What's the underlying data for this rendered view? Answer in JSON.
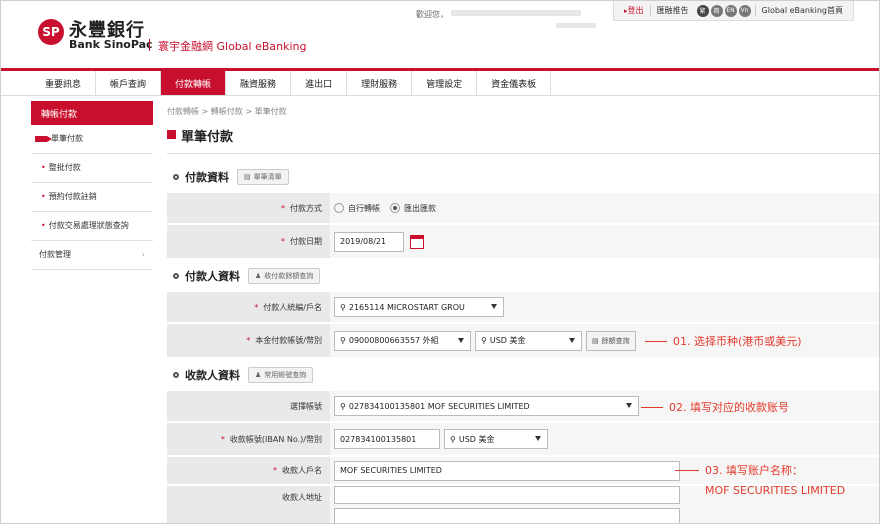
{
  "header": {
    "logo_mark": "SP",
    "brand_cn": "永豐銀行",
    "brand_en": "Bank SinoPac",
    "tagline": "寰宇金融網 Global eBanking",
    "welcome": "歡迎您，",
    "logout": "登出",
    "logout_icon": "triangle-right-icon",
    "links": [
      "匯融推告"
    ],
    "circles": [
      "繁",
      "简",
      "EN",
      "Vn"
    ],
    "home": "Global eBanking首頁"
  },
  "nav": {
    "items": [
      "重要訊息",
      "帳戶查詢",
      "付款轉帳",
      "融資服務",
      "進出口",
      "理財服務",
      "管理設定",
      "資金儀表板"
    ],
    "active_index": 2
  },
  "sidebar": {
    "title": "轉帳付款",
    "items": [
      {
        "label": "單筆付款",
        "current": true
      },
      {
        "label": "整批付款"
      },
      {
        "label": "預約付款註銷"
      },
      {
        "label": "付款交易處理狀態查詢"
      },
      {
        "label": "付款管理"
      }
    ]
  },
  "breadcrumb": "付款轉帳 > 轉帳付款 > 單筆付款",
  "page_title": "單筆付款",
  "sections": {
    "payment": {
      "title": "付款資料",
      "button": "單筆清單",
      "method_label": "付款方式",
      "method_options": [
        "自行轉帳",
        "匯出匯款"
      ],
      "method_selected": 1,
      "date_label": "付款日期",
      "date_value": "2019/08/21"
    },
    "payer": {
      "title": "付款人資料",
      "button": "收付款餘額查詢",
      "id_label": "付款人統編/戶名",
      "id_value": "2165114 MICROSTART GROU",
      "account_label": "本金付款帳號/幣別",
      "account_value": "09000800663557 外組",
      "currency_value": "USD 美金",
      "balance_button": "餘額查詢"
    },
    "payee": {
      "title": "收款人資料",
      "button": "常用帳號查詢",
      "select_label": "選擇帳號",
      "select_value": "027834100135801 MOF SECURITIES LIMITED",
      "iban_label": "收款帳號(IBAN No.)/幣別",
      "iban_value": "027834100135801",
      "iban_currency": "USD 美金",
      "name_label": "收款人戶名",
      "name_value": "MOF SECURITIES LIMITED",
      "address_label": "收款人地址"
    }
  },
  "annotations": {
    "a1": "01. 选择币种(港币或美元)",
    "a2": "02. 填写对应的收款账号",
    "a3": "03. 填写账户名称：",
    "a3b": "MOF SECURITIES LIMITED"
  },
  "colors": {
    "brand": "#c8102e",
    "annotation": "#e23b2c"
  }
}
